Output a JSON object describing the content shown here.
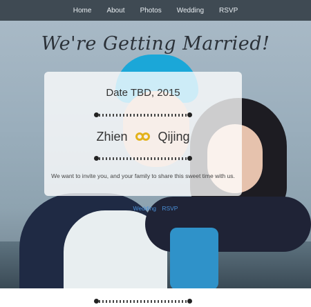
{
  "nav": {
    "items": [
      {
        "label": "Home"
      },
      {
        "label": "About"
      },
      {
        "label": "Photos"
      },
      {
        "label": "Wedding"
      },
      {
        "label": "RSVP"
      }
    ]
  },
  "hero": {
    "script_title": "We're Getting Married!"
  },
  "card": {
    "date": "Date TBD, 2015",
    "name_left": "Zhien",
    "name_right": "Qijing",
    "invite_text": "We want to invite you, and your family to share this sweet time with us."
  },
  "links": {
    "wedding": "Wedding",
    "rsvp": "RSVP"
  },
  "colors": {
    "nav_bg": "#3f4a53",
    "link": "#4a90d9",
    "ring_gold": "#e3b21b"
  },
  "icons": [
    "rings-icon",
    "divider-ornament"
  ]
}
